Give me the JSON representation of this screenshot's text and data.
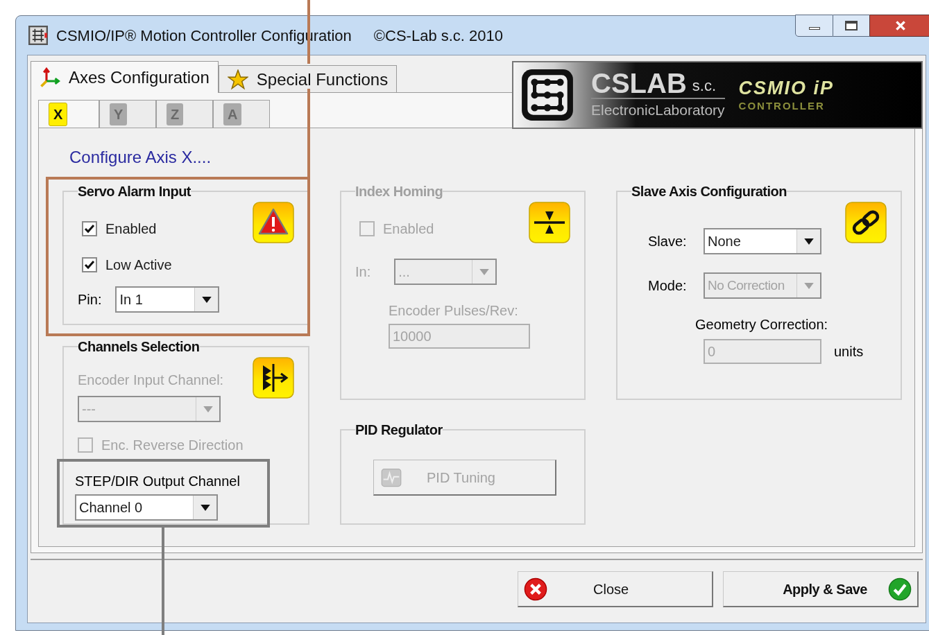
{
  "window": {
    "title": "CSMIO/IP® Motion Controller Configuration",
    "copyright": "©CS-Lab s.c. 2010"
  },
  "tabs": [
    {
      "label": "Axes Configuration",
      "kind": "axes",
      "selected": true
    },
    {
      "label": "Special Functions",
      "kind": "star",
      "selected": false
    }
  ],
  "logo": {
    "brand": "CSLAB",
    "suffix": "s.c.",
    "tagline": "ElectronicLaboratory",
    "product": "CSMIO iP",
    "product_sub": "CONTROLLER"
  },
  "axis_tabs": [
    {
      "label": "X",
      "selected": true
    },
    {
      "label": "Y",
      "selected": false
    },
    {
      "label": "Z",
      "selected": false
    },
    {
      "label": "A",
      "selected": false
    }
  ],
  "heading": "Configure Axis X....",
  "servo_alarm": {
    "title": "Servo Alarm Input",
    "enabled": {
      "label": "Enabled",
      "checked": true
    },
    "low_active": {
      "label": "Low Active",
      "checked": true
    },
    "pin": {
      "label": "Pin:",
      "value": "In 1"
    }
  },
  "channels_selection": {
    "title": "Channels Selection",
    "encoder_input": {
      "label": "Encoder Input Channel:",
      "value": "---",
      "disabled": true
    },
    "enc_reverse": {
      "label": "Enc. Reverse Direction",
      "checked": false,
      "disabled": true
    },
    "step_dir": {
      "label": "STEP/DIR Output Channel",
      "value": "Channel 0"
    }
  },
  "index_homing": {
    "title": "Index Homing",
    "disabled": true,
    "enabled": {
      "label": "Enabled",
      "checked": false
    },
    "input": {
      "label": "In:",
      "value": "..."
    },
    "pulses": {
      "label": "Encoder Pulses/Rev:",
      "value": "10000"
    }
  },
  "pid": {
    "title": "PID Regulator",
    "button": {
      "label": "PID Tuning",
      "disabled": true
    }
  },
  "slave_axis": {
    "title": "Slave Axis Configuration",
    "slave": {
      "label": "Slave:",
      "value": "None"
    },
    "mode": {
      "label": "Mode:",
      "value": "No Correction",
      "disabled": true
    },
    "geometry": {
      "label": "Geometry Correction:",
      "value": "0",
      "unit": "units",
      "disabled": true
    }
  },
  "buttons": [
    {
      "label": "Close",
      "kind": "close"
    },
    {
      "label": "Apply & Save",
      "kind": "apply"
    }
  ]
}
